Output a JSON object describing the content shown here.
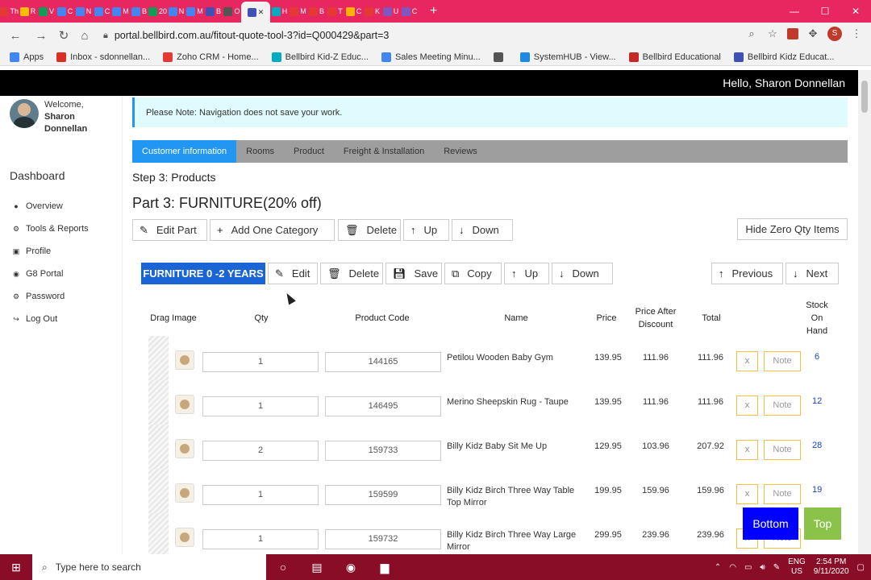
{
  "browser": {
    "tabs": [
      {
        "label": "Th",
        "color": "#e53935"
      },
      {
        "label": "R",
        "color": "#fbbc04"
      },
      {
        "label": "V",
        "color": "#0f9d58"
      },
      {
        "label": "C",
        "color": "#4285f4"
      },
      {
        "label": "N",
        "color": "#4285f4"
      },
      {
        "label": "C",
        "color": "#4285f4"
      },
      {
        "label": "M",
        "color": "#4285f4"
      },
      {
        "label": "B",
        "color": "#4285f4"
      },
      {
        "label": "20",
        "color": "#0f9d58"
      },
      {
        "label": "N",
        "color": "#4285f4"
      },
      {
        "label": "M",
        "color": "#4285f4"
      },
      {
        "label": "B",
        "color": "#3f51b5"
      },
      {
        "label": "O",
        "color": "#555"
      },
      {
        "label": "H",
        "color": "#00acc1"
      },
      {
        "label": "M",
        "color": "#e53935"
      },
      {
        "label": "B",
        "color": "#e53935"
      },
      {
        "label": "T",
        "color": "#e53935"
      },
      {
        "label": "C",
        "color": "#ffb300"
      },
      {
        "label": "K",
        "color": "#e53935"
      },
      {
        "label": "U",
        "color": "#7e57c2"
      },
      {
        "label": "C",
        "color": "#7e57c2"
      }
    ],
    "active_tab_close": "✕",
    "new_tab": "+",
    "url": "portal.bellbird.com.au/fitout-quote-tool-3?id=Q000429&part=3",
    "profile_initial": "S",
    "window_controls": {
      "minimize": "—",
      "maximize": "☐",
      "close": "✕"
    },
    "bookmarks": [
      {
        "label": "Apps",
        "color": "#4285f4"
      },
      {
        "label": "Inbox - sdonnellan...",
        "color": "#d93025"
      },
      {
        "label": "Zoho CRM - Home...",
        "color": "#e53935"
      },
      {
        "label": "Bellbird Kid-Z Educ...",
        "color": "#00acc1"
      },
      {
        "label": "Sales Meeting Minu...",
        "color": "#4285f4"
      },
      {
        "label": "",
        "color": "#555"
      },
      {
        "label": "SystemHUB - View...",
        "color": "#1e88e5"
      },
      {
        "label": "Bellbird Educational",
        "color": "#c62828"
      },
      {
        "label": "Bellbird Kidz Educat...",
        "color": "#3f51b5"
      }
    ]
  },
  "header": {
    "greeting": "Hello, Sharon Donnellan"
  },
  "sidebar": {
    "welcome": "Welcome,",
    "first_name": "Sharon",
    "last_name": "Donnellan",
    "dashboard": "Dashboard",
    "items": [
      {
        "label": "Overview",
        "icon": "●"
      },
      {
        "label": "Tools & Reports",
        "icon": "⚙"
      },
      {
        "label": "Profile",
        "icon": "▣"
      },
      {
        "label": "G8 Portal",
        "icon": "◉"
      },
      {
        "label": "Password",
        "icon": "⚙"
      },
      {
        "label": "Log Out",
        "icon": "↪"
      }
    ]
  },
  "main": {
    "notice": "Please Note: Navigation does not save your work.",
    "tabs": [
      "Customer information",
      "Rooms",
      "Product",
      "Freight & Installation",
      "Reviews"
    ],
    "step": "Step 3: Products",
    "part_title": "Part 3: FURNITURE(20% off)",
    "part_buttons": {
      "edit": "Edit Part",
      "add": "Add One Category",
      "delete": "Delete",
      "up": "Up",
      "down": "Down"
    },
    "hide_zero": "Hide Zero Qty Items",
    "category": {
      "label": "FURNITURE 0 -2 YEARS",
      "edit": "Edit",
      "delete": "Delete",
      "save": "Save",
      "copy": "Copy",
      "up": "Up",
      "down": "Down",
      "previous": "Previous",
      "next": "Next"
    },
    "columns": {
      "drag_image": "Drag Image",
      "qty": "Qty",
      "product_code": "Product Code",
      "name": "Name",
      "price": "Price",
      "price_after": "Price After Discount",
      "total": "Total",
      "stock": "Stock On Hand"
    },
    "rows": [
      {
        "qty": "1",
        "code": "144165",
        "name": "Petilou Wooden Baby Gym",
        "price": "139.95",
        "after": "111.96",
        "total": "111.96",
        "stock": "6"
      },
      {
        "qty": "1",
        "code": "146495",
        "name": "Merino Sheepskin Rug - Taupe",
        "price": "139.95",
        "after": "111.96",
        "total": "111.96",
        "stock": "12"
      },
      {
        "qty": "2",
        "code": "159733",
        "name": "Billy Kidz Baby Sit Me Up",
        "price": "129.95",
        "after": "103.96",
        "total": "207.92",
        "stock": "28"
      },
      {
        "qty": "1",
        "code": "159599",
        "name": "Billy Kidz Birch Three Way Table Top Mirror",
        "price": "199.95",
        "after": "159.96",
        "total": "159.96",
        "stock": "19"
      },
      {
        "qty": "1",
        "code": "159732",
        "name": "Billy Kidz Birch Three Way Large Mirror",
        "price": "299.95",
        "after": "239.96",
        "total": "239.96",
        "stock": ""
      }
    ],
    "row_x": "x",
    "row_note": "Note",
    "bottom_btn": "Bottom",
    "top_btn": "Top"
  },
  "taskbar": {
    "search": "Type here to search",
    "lang": "ENG",
    "region": "US",
    "time": "2:54 PM",
    "date": "9/11/2020"
  },
  "colors": {
    "brand_blue": "#2196f3",
    "bottom_blue": "#0000ff",
    "top_green": "#8bc34a",
    "tab_bar": "#e8265f"
  }
}
